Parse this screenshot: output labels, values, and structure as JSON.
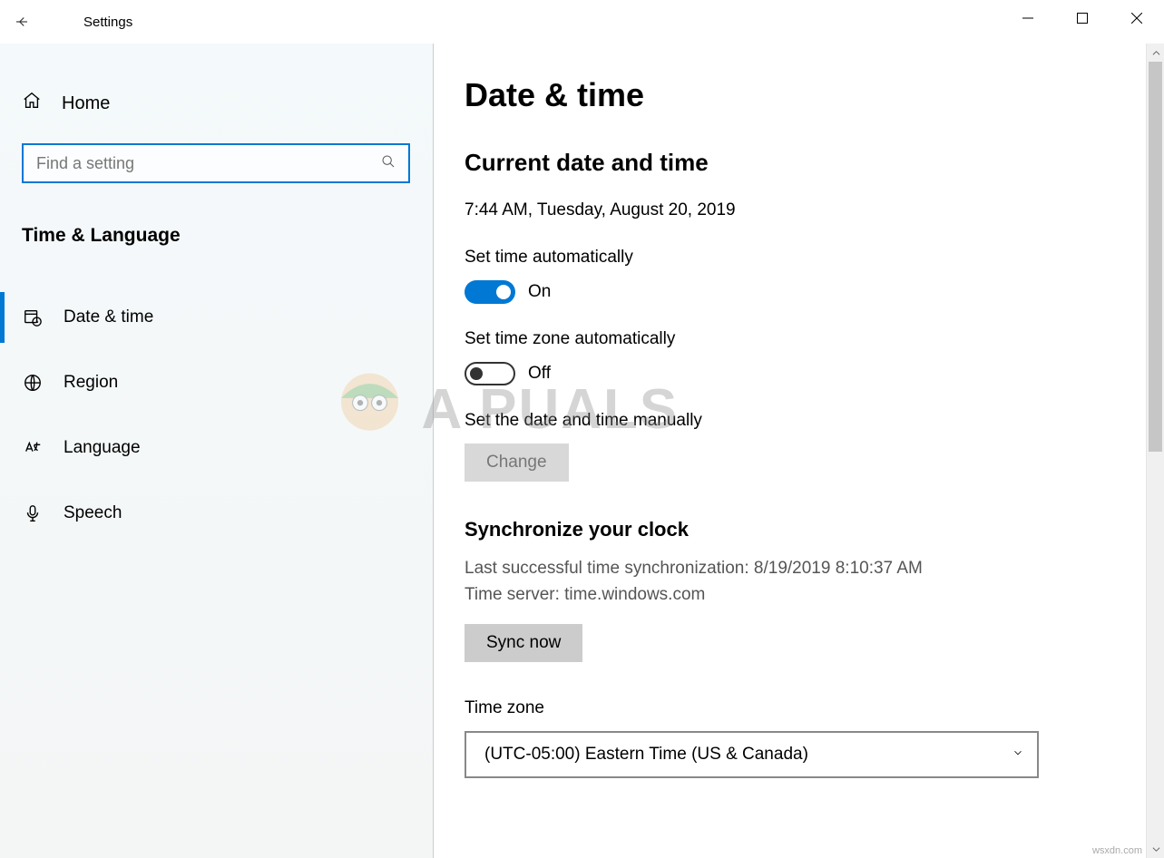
{
  "window": {
    "title": "Settings"
  },
  "sidebar": {
    "home_label": "Home",
    "search_placeholder": "Find a setting",
    "section_heading": "Time & Language",
    "items": [
      {
        "label": "Date & time",
        "active": true
      },
      {
        "label": "Region",
        "active": false
      },
      {
        "label": "Language",
        "active": false
      },
      {
        "label": "Speech",
        "active": false
      }
    ]
  },
  "main": {
    "page_title": "Date & time",
    "current_heading": "Current date and time",
    "current_value": "7:44 AM, Tuesday, August 20, 2019",
    "set_time_auto": {
      "label": "Set time automatically",
      "state": "On"
    },
    "set_tz_auto": {
      "label": "Set time zone automatically",
      "state": "Off"
    },
    "manual": {
      "label": "Set the date and time manually",
      "button": "Change"
    },
    "sync": {
      "heading": "Synchronize your clock",
      "last_sync": "Last successful time synchronization: 8/19/2019 8:10:37 AM",
      "server": "Time server: time.windows.com",
      "button": "Sync now"
    },
    "timezone": {
      "label": "Time zone",
      "value": "(UTC-05:00) Eastern Time (US & Canada)"
    }
  },
  "watermark": {
    "logo_text": "A PUALS",
    "url": "wsxdn.com"
  }
}
